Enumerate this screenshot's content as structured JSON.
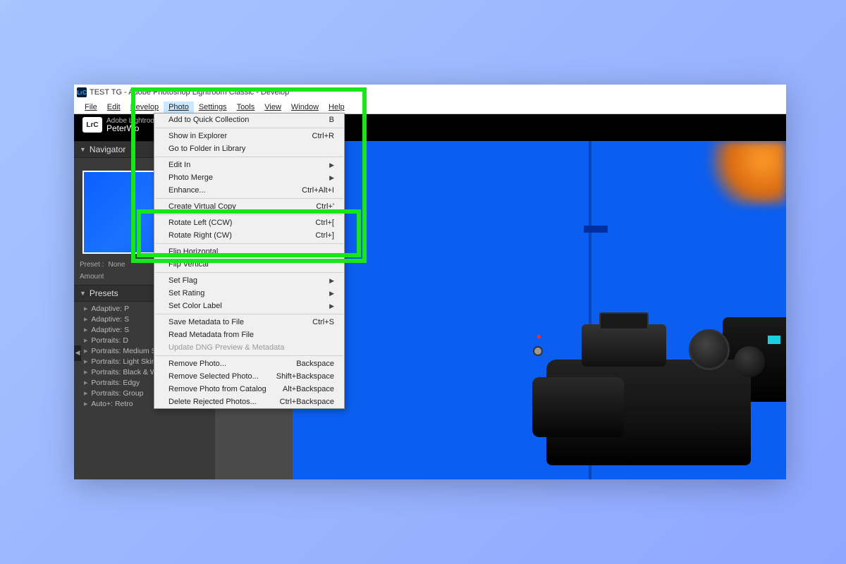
{
  "titlebar": {
    "icon_text": "LrC",
    "title": "TEST TG - Adobe Photoshop Lightroom Classic - Develop"
  },
  "menubar": {
    "file": "File",
    "edit": "Edit",
    "develop": "Develop",
    "photo": "Photo",
    "settings": "Settings",
    "tools": "Tools",
    "view": "View",
    "window": "Window",
    "help": "Help"
  },
  "identity": {
    "product": "Adobe Lightroom",
    "user": "PeterWo"
  },
  "panels": {
    "navigator": "Navigator",
    "preset_label": "Preset :",
    "preset_value": "None",
    "amount_label": "Amount",
    "presets": "Presets",
    "preset_items": [
      "Adaptive: P",
      "Adaptive: S",
      "Adaptive: S",
      "Portraits: D",
      "Portraits: Medium Skin",
      "Portraits: Light Skin",
      "Portraits: Black & White",
      "Portraits: Edgy",
      "Portraits: Group",
      "Auto+: Retro"
    ]
  },
  "menu": {
    "items": [
      {
        "label": "Add to Quick Collection",
        "shortcut": "B"
      },
      {
        "sep": true
      },
      {
        "label": "Show in Explorer",
        "shortcut": "Ctrl+R"
      },
      {
        "label": "Go to Folder in Library",
        "shortcut": ""
      },
      {
        "sep": true
      },
      {
        "label": "Edit In",
        "sub": true
      },
      {
        "label": "Photo Merge",
        "sub": true
      },
      {
        "label": "Enhance...",
        "shortcut": "Ctrl+Alt+I"
      },
      {
        "sep": true
      },
      {
        "label": "Create Virtual Copy",
        "shortcut": "Ctrl+'"
      },
      {
        "sep": true
      },
      {
        "label": "Rotate Left (CCW)",
        "shortcut": "Ctrl+["
      },
      {
        "label": "Rotate Right (CW)",
        "shortcut": "Ctrl+]"
      },
      {
        "sep": true
      },
      {
        "label": "Flip Horizontal",
        "shortcut": ""
      },
      {
        "label": "Flip Vertical",
        "shortcut": ""
      },
      {
        "sep": true
      },
      {
        "label": "Set Flag",
        "sub": true
      },
      {
        "label": "Set Rating",
        "sub": true
      },
      {
        "label": "Set Color Label",
        "sub": true
      },
      {
        "sep": true
      },
      {
        "label": "Save Metadata to File",
        "shortcut": "Ctrl+S"
      },
      {
        "label": "Read Metadata from File",
        "shortcut": ""
      },
      {
        "label": "Update DNG Preview & Metadata",
        "disabled": true
      },
      {
        "sep": true
      },
      {
        "label": "Remove Photo...",
        "shortcut": "Backspace"
      },
      {
        "label": "Remove Selected Photo...",
        "shortcut": "Shift+Backspace"
      },
      {
        "label": "Remove Photo from Catalog",
        "shortcut": "Alt+Backspace"
      },
      {
        "label": "Delete Rejected Photos...",
        "shortcut": "Ctrl+Backspace"
      }
    ]
  }
}
